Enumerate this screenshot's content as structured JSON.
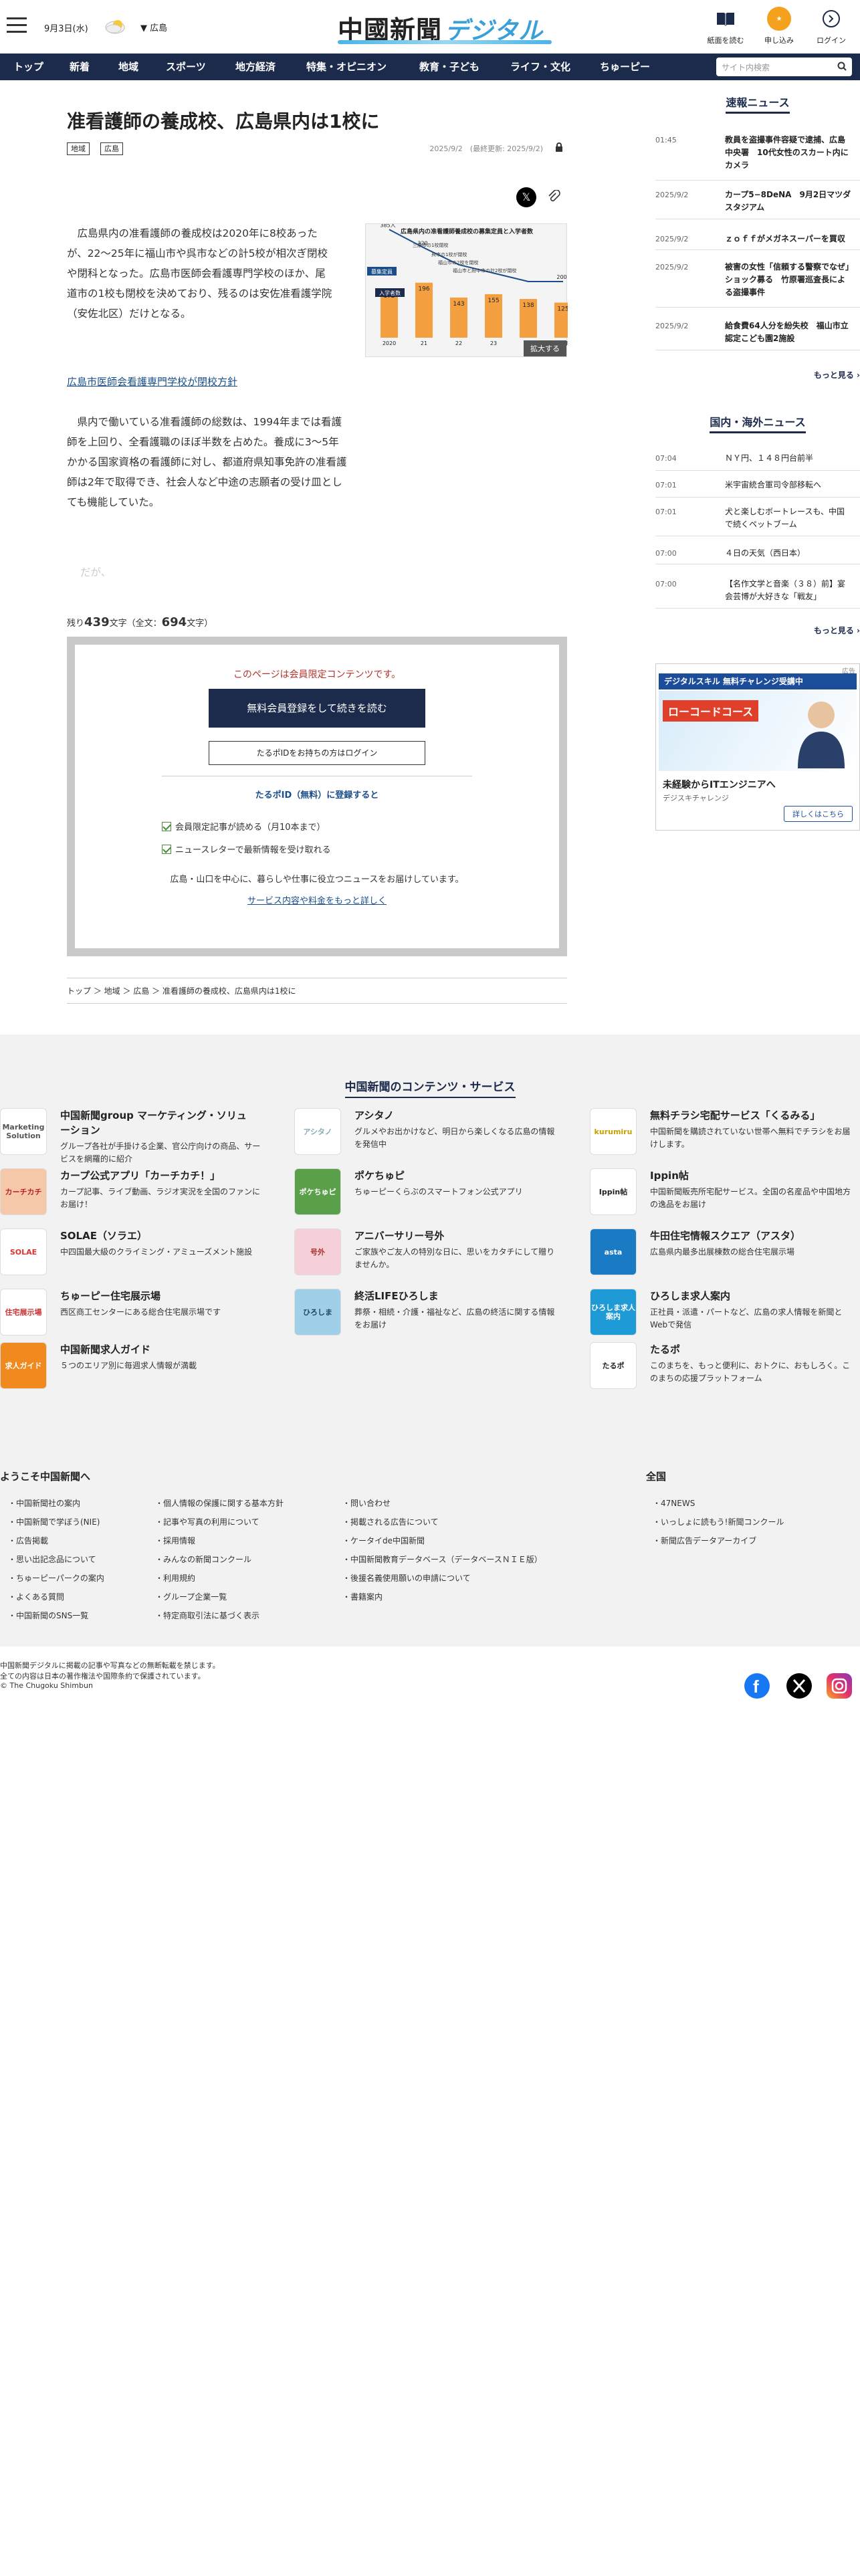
{
  "header": {
    "date": "9月3日(水)",
    "region": "広島",
    "logo_main": "中國新聞",
    "logo_sub": "デジタル",
    "btn_paper": "紙面を読む",
    "btn_apply": "申し込み",
    "btn_login": "ログイン"
  },
  "nav": {
    "items": [
      "トップ",
      "新着",
      "地域",
      "スポーツ",
      "地方経済",
      "特集・オピニオン",
      "教育・子ども",
      "ライフ・文化",
      "ちゅーピー"
    ],
    "search_placeholder": "サイト内検索"
  },
  "article": {
    "title": "准看護師の養成校、広島県内は1校に",
    "tags": [
      "地域",
      "広島"
    ],
    "date": "2025/9/2　(最終更新: 2025/9/2)",
    "lead": "広島県内の准看護師の養成校は2020年に8校あったが、22〜25年に福山市や呉市などの計5校が相次ぎ閉校や閉科となった。広島市医師会看護専門学校のほか、尾道市の1校も閉校を決めており、残るのは安佐准看護学院（安佐北区）だけとなる。",
    "related_link": "広島市医師会看護専門学校が閉校方針",
    "para2": "県内で働いている准看護師の総数は、1994年までは看護師を上回り、全看護職のほぼ半数を占めた。養成に3〜5年かかる国家資格の看護師に対し、都道府県知事免許の准看護師は2年で取得でき、社会人など中途の志願者の受け皿としても機能していた。",
    "fade": "だが、",
    "remain_prefix": "残り",
    "remain_count": "439",
    "remain_mid": "文字（全文：",
    "total_count": "694",
    "remain_suffix": "文字）",
    "zoom_label": "拡大する"
  },
  "chart_data": {
    "type": "bar",
    "title": "広島県内の准看護師養成校の募集定員と入学者数",
    "categories": [
      "2020",
      "21",
      "22",
      "23",
      "24",
      "25年"
    ],
    "series": [
      {
        "name": "入学者数",
        "values": [
          172,
          196,
          143,
          155,
          138,
          125
        ]
      },
      {
        "name": "募集定員",
        "values": [
          385,
          320,
          260,
          230,
          200,
          200
        ]
      }
    ],
    "bar_labels": [
      "172",
      "196",
      "143",
      "155",
      "138",
      "125"
    ],
    "line_labels": [
      "385人",
      "320",
      "",
      "",
      "",
      "200"
    ],
    "annotations": [
      "三原市の1校閉校",
      "呉市の1校が閉校",
      "福山市の2校を閉校",
      "福山市と府中市の計2校が閉校"
    ],
    "legend": [
      "募集定員",
      "入学者数"
    ]
  },
  "paywall": {
    "message": "このページは会員限定コンテンツです。",
    "register_btn": "無料会員登録をして続きを読む",
    "login_btn": "たるポIDをお持ちの方はログイン",
    "heading": "たるポID（無料）に登録すると",
    "benefits": [
      "会員限定記事が読める（月10本まで）",
      "ニュースレターで最新情報を受け取れる"
    ],
    "note": "広島・山口を中心に、暮らしや仕事に役立つニュースをお届けしています。",
    "more": "サービス内容や料金をもっと詳しく"
  },
  "breadcrumb": "トップ ＞ 地域 ＞ 広島 ＞ 准看護師の養成校、広島県内は1校に",
  "sidebar": {
    "breaking_title": "速報ニュース",
    "breaking": [
      {
        "t": "01:45",
        "x": "教員を盗撮事件容疑で逮捕、広島中央署　10代女性のスカート内にカメラ"
      },
      {
        "t": "2025/9/2",
        "x": "カープ5−8DeNA　9月2日マツダスタジアム"
      },
      {
        "t": "2025/9/2",
        "x": "ｚｏｆｆがメガネスーパーを買収"
      },
      {
        "t": "2025/9/2",
        "x": "被害の女性「信頼する警察でなぜ」ショック募る　竹原署巡査長による盗撮事件"
      },
      {
        "t": "2025/9/2",
        "x": "給食費64人分を紛失校　福山市立認定こども園2施設"
      }
    ],
    "breaking_more": "もっと見る",
    "world_title": "国内・海外ニュース",
    "world": [
      {
        "t": "07:04",
        "x": "ＮＹ円、１４８円台前半"
      },
      {
        "t": "07:01",
        "x": "米宇宙統合軍司令部移転へ"
      },
      {
        "t": "07:01",
        "x": "犬と楽しむボートレースも、中国で続くペットブーム"
      },
      {
        "t": "07:00",
        "x": "４日の天気（西日本）"
      },
      {
        "t": "07:00",
        "x": "【名作文学と音楽（３８）前】宴会芸博が大好きな「戦友」"
      }
    ],
    "world_more": "もっと見る",
    "ad_label": "広告",
    "ad_title": "デジタルスキル 無料チャレンジ受講中",
    "ad_course": "ローコードコース",
    "ad_headline": "未経験からITエンジニアへ",
    "ad_company": "デジスキチャレンジ",
    "ad_btn": "詳しくはこちら"
  },
  "footer": {
    "heading": "中国新聞のコンテンツ・サービス",
    "services": [
      {
        "name": "中国新聞group マーケティング・ソリューション",
        "desc": "グループ各社が手掛ける企業、官公庁向けの商品、サービスを網羅的に紹介",
        "logo": "Marketing Solution",
        "color": "#ffffff",
        "fg": "#555"
      },
      {
        "name": "アシタノ",
        "desc": "グルメやお出かけなど、明日から楽しくなる広島の情報を発信中",
        "logo": "アシタノ",
        "color": "#ffffff",
        "fg": "#8ab"
      },
      {
        "name": "無料チラシ宅配サービス「くるみる」",
        "desc": "中国新聞を購読されていない世帯へ無料でチラシをお届けします。",
        "logo": "kurumiru",
        "color": "#ffffff",
        "fg": "#c8a000"
      },
      {
        "name": "カープ公式アプリ「カーチカチ！」",
        "desc": "カープ記事、ライブ動画、ラジオ実況を全国のファンにお届け！",
        "logo": "カーチカチ",
        "color": "#f4c8a8",
        "fg": "#b22"
      },
      {
        "name": "ポケちゅピ",
        "desc": "ちゅーピーくらぶのスマートフォン公式アプリ",
        "logo": "ポケちゅピ",
        "color": "#5aa04a",
        "fg": "#fff"
      },
      {
        "name": "Ippin帖",
        "desc": "中国新聞販売所宅配サービス。全国の名産品や中国地方の逸品をお届け",
        "logo": "Ippin帖",
        "color": "#ffffff",
        "fg": "#222"
      },
      {
        "name": "SOLAE（ソラエ）",
        "desc": "中四国最大級のクライミング・アミューズメント施設",
        "logo": "SOLAE",
        "color": "#ffffff",
        "fg": "#d33"
      },
      {
        "name": "アニバーサリー号外",
        "desc": "ご家族やご友人の特別な日に、思いをカタチにして贈りませんか。",
        "logo": "号外",
        "color": "#f6d0d8",
        "fg": "#a33"
      },
      {
        "name": "牛田住宅情報スクエア（アスタ）",
        "desc": "広島県内最多出展棟数の総合住宅展示場",
        "logo": "asta",
        "color": "#1a7ac4",
        "fg": "#fff"
      },
      {
        "name": "ちゅーピー住宅展示場",
        "desc": "西区商工センターにある総合住宅展示場です",
        "logo": "住宅展示場",
        "color": "#ffffff",
        "fg": "#c33"
      },
      {
        "name": "終活LIFEひろしま",
        "desc": "葬祭・相続・介護・福祉など、広島の終活に関する情報をお届け",
        "logo": "ひろしま",
        "color": "#9fd0e8",
        "fg": "#246"
      },
      {
        "name": "ひろしま求人案内",
        "desc": "正社員・派遣・パートなど、広島の求人情報を新聞とWebで発信",
        "logo": "ひろしま求人案内",
        "color": "#1e9ad6",
        "fg": "#fff"
      },
      {
        "name": "中国新聞求人ガイド",
        "desc": "５つのエリア別に毎週求人情報が満載",
        "logo": "求人ガイド",
        "color": "#f08a1e",
        "fg": "#fff"
      },
      {
        "name": "",
        "desc": "",
        "logo": "",
        "color": "transparent",
        "fg": "#000"
      },
      {
        "name": "たるポ",
        "desc": "このまちを、もっと便利に、おトクに、おもしろく。このまちの応援プラットフォーム",
        "logo": "たるポ",
        "color": "#ffffff",
        "fg": "#222"
      }
    ],
    "welcome_title": "ようこそ中国新聞へ",
    "col1": [
      "中国新聞社の案内",
      "中国新聞で学ぼう(NIE)",
      "広告掲載",
      "思い出記念品について",
      "ちゅーピーパークの案内",
      "よくある質問",
      "中国新聞のSNS一覧"
    ],
    "col2": [
      "個人情報の保護に関する基本方針",
      "記事や写真の利用について",
      "採用情報",
      "みんなの新聞コンクール",
      "利用規約",
      "グループ企業一覧",
      "特定商取引法に基づく表示"
    ],
    "col3": [
      "問い合わせ",
      "掲載される広告について",
      "ケータイde中国新聞",
      "中国新聞教育データベース（データベースＮＩＥ版）",
      "後援名義使用願いの申請について",
      "書籍案内"
    ],
    "zenkoku_title": "全国",
    "col4": [
      "47NEWS",
      "いっしょに読もう!新聞コンクール",
      "新聞広告データアーカイブ"
    ],
    "copy1": "中国新聞デジタルに掲載の記事や写真などの無断転載を禁じます。",
    "copy2": "全ての内容は日本の著作権法や国際条約で保護されています。",
    "copy3": "© The Chugoku Shimbun"
  }
}
